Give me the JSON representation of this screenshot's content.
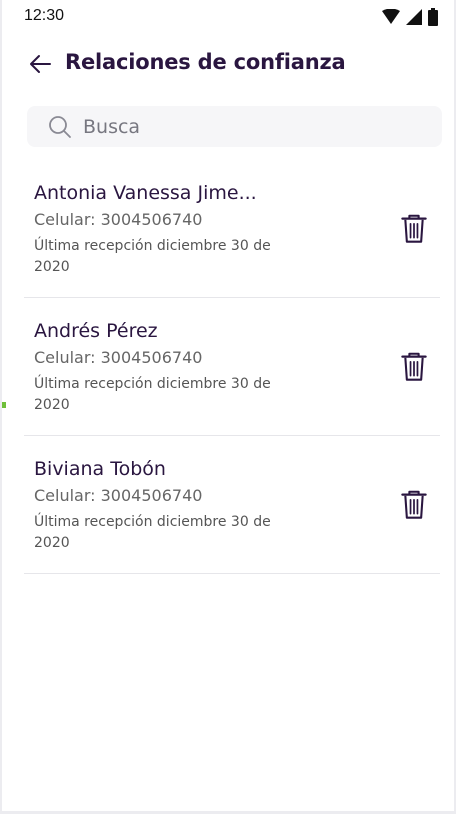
{
  "status_bar": {
    "time": "12:30",
    "icons": [
      "wifi-icon",
      "signal-icon",
      "battery-icon"
    ]
  },
  "header": {
    "back_icon": "arrow-left-icon",
    "title": "Relaciones de confianza"
  },
  "search": {
    "icon": "search-icon",
    "placeholder": "Busca",
    "value": ""
  },
  "contacts": [
    {
      "name": "Antonia Vanessa Jime...",
      "phone": "Celular: 3004506740",
      "last_reception": "Última recepción diciembre 30 de 2020",
      "delete_icon": "trash-icon"
    },
    {
      "name": "Andrés Pérez",
      "phone": "Celular: 3004506740",
      "last_reception": "Última recepción diciembre 30 de 2020",
      "delete_icon": "trash-icon"
    },
    {
      "name": "Biviana Tobón",
      "phone": "Celular: 3004506740",
      "last_reception": "Última recepción diciembre 30 de 2020",
      "delete_icon": "trash-icon"
    }
  ],
  "colors": {
    "title": "#2a1640",
    "divider": "#e6e6ea",
    "search_bg": "#f6f6f8"
  }
}
